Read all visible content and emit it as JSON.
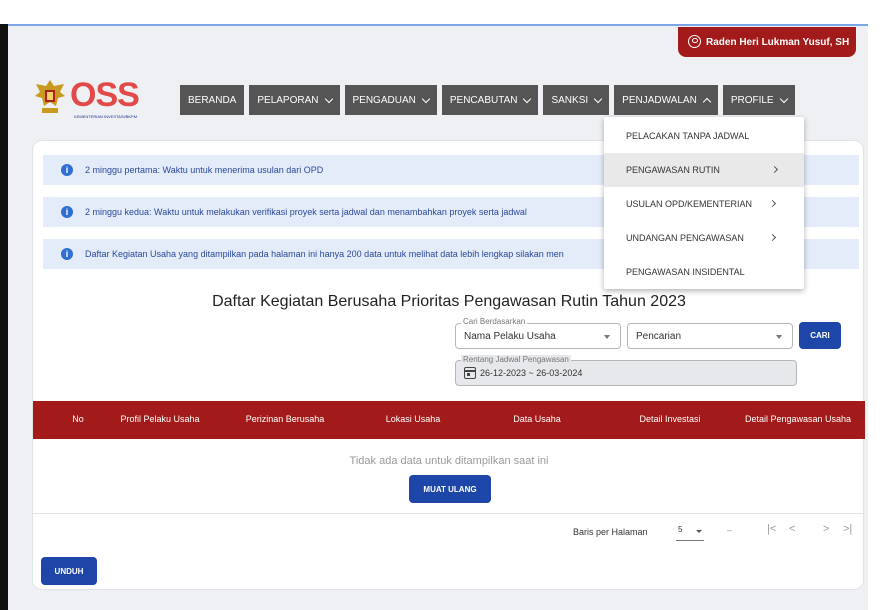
{
  "user": {
    "name": "Raden Heri Lukman Yusuf, SH"
  },
  "logo": {
    "text": "OSS",
    "subtitle": "KEMENTERIAN INVESTASI/BKPM"
  },
  "nav": [
    {
      "label": "BERANDA"
    },
    {
      "label": "PELAPORAN"
    },
    {
      "label": "PENGADUAN"
    },
    {
      "label": "PENCABUTAN"
    },
    {
      "label": "SANKSI"
    },
    {
      "label": "PENJADWALAN"
    },
    {
      "label": "PROFILE"
    }
  ],
  "dropdown": [
    {
      "label": "PELACAKAN TANPA JADWAL"
    },
    {
      "label": "PENGAWASAN RUTIN"
    },
    {
      "label": "USULAN OPD/KEMENTERIAN"
    },
    {
      "label": "UNDANGAN PENGAWASAN"
    },
    {
      "label": "PENGAWASAN INSIDENTAL"
    }
  ],
  "info": [
    "2 minggu pertama: Waktu untuk menerima usulan dari OPD",
    "2 minggu kedua: Waktu untuk melakukan verifikasi proyek serta jadwal dan menambahkan proyek serta jadwal",
    "Daftar Kegiatan Usaha yang ditampilkan pada halaman ini hanya 200 data untuk melihat data lebih lengkap silakan men"
  ],
  "page_title": "Daftar Kegiatan Berusaha Prioritas Pengawasan Rutin Tahun 2023",
  "search": {
    "by_label": "Cari Berdasarkan",
    "by_value": "Nama Pelaku Usaha",
    "query_value": "Pencarian",
    "button": "CARI"
  },
  "date_range": {
    "label": "Rentang Jadwal Pengawasan",
    "value": "26-12-2023 ~ 26-03-2024"
  },
  "table": {
    "headers": [
      "No",
      "Profil Pelaku Usaha",
      "Perizinan Berusaha",
      "Lokasi Usaha",
      "Data Usaha",
      "Detail Investasi",
      "Detail Pengawasan Usaha"
    ],
    "empty_text": "Tidak ada data untuk ditampilkan saat ini",
    "reload_button": "MUAT ULANG"
  },
  "pagination": {
    "rows_label": "Baris per Halaman",
    "rows_value": "5",
    "range": "–",
    "first": "|<",
    "prev": "<",
    "next": ">",
    "last": ">|"
  },
  "download_button": "UNDUH",
  "colors": {
    "primary_red": "#a31a1a",
    "nav_grey": "#555555",
    "button_blue": "#1e46a8",
    "info_bg": "#e4ebf9"
  }
}
